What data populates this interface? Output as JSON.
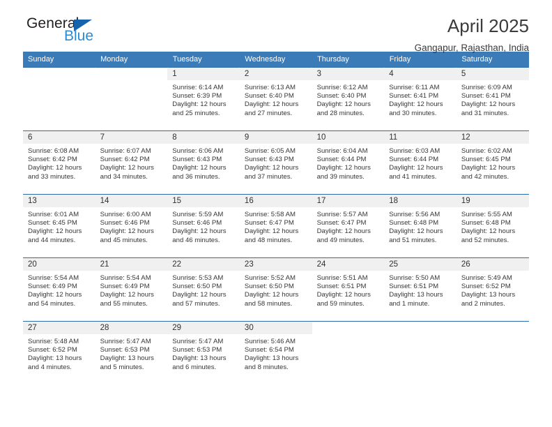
{
  "brand": {
    "name_part1": "General",
    "name_part2": "Blue",
    "triangle_color": "#1663ad",
    "blue_text_color": "#2a8bd4"
  },
  "header": {
    "title": "April 2025",
    "subtitle": "Gangapur, Rajasthan, India"
  },
  "theme": {
    "header_bg": "#3b7cb8",
    "week_divider": "#2d6ca8",
    "daynum_bg": "#f0f0f0"
  },
  "calendar": {
    "weekday_headers": [
      "Sunday",
      "Monday",
      "Tuesday",
      "Wednesday",
      "Thursday",
      "Friday",
      "Saturday"
    ],
    "labels": {
      "sunrise": "Sunrise:",
      "sunset": "Sunset:",
      "daylight": "Daylight:"
    },
    "weeks": [
      [
        {
          "day": "",
          "sunrise": "",
          "sunset": "",
          "daylight": ""
        },
        {
          "day": "",
          "sunrise": "",
          "sunset": "",
          "daylight": ""
        },
        {
          "day": "1",
          "sunrise": "Sunrise: 6:14 AM",
          "sunset": "Sunset: 6:39 PM",
          "daylight": "Daylight: 12 hours and 25 minutes."
        },
        {
          "day": "2",
          "sunrise": "Sunrise: 6:13 AM",
          "sunset": "Sunset: 6:40 PM",
          "daylight": "Daylight: 12 hours and 27 minutes."
        },
        {
          "day": "3",
          "sunrise": "Sunrise: 6:12 AM",
          "sunset": "Sunset: 6:40 PM",
          "daylight": "Daylight: 12 hours and 28 minutes."
        },
        {
          "day": "4",
          "sunrise": "Sunrise: 6:11 AM",
          "sunset": "Sunset: 6:41 PM",
          "daylight": "Daylight: 12 hours and 30 minutes."
        },
        {
          "day": "5",
          "sunrise": "Sunrise: 6:09 AM",
          "sunset": "Sunset: 6:41 PM",
          "daylight": "Daylight: 12 hours and 31 minutes."
        }
      ],
      [
        {
          "day": "6",
          "sunrise": "Sunrise: 6:08 AM",
          "sunset": "Sunset: 6:42 PM",
          "daylight": "Daylight: 12 hours and 33 minutes."
        },
        {
          "day": "7",
          "sunrise": "Sunrise: 6:07 AM",
          "sunset": "Sunset: 6:42 PM",
          "daylight": "Daylight: 12 hours and 34 minutes."
        },
        {
          "day": "8",
          "sunrise": "Sunrise: 6:06 AM",
          "sunset": "Sunset: 6:43 PM",
          "daylight": "Daylight: 12 hours and 36 minutes."
        },
        {
          "day": "9",
          "sunrise": "Sunrise: 6:05 AM",
          "sunset": "Sunset: 6:43 PM",
          "daylight": "Daylight: 12 hours and 37 minutes."
        },
        {
          "day": "10",
          "sunrise": "Sunrise: 6:04 AM",
          "sunset": "Sunset: 6:44 PM",
          "daylight": "Daylight: 12 hours and 39 minutes."
        },
        {
          "day": "11",
          "sunrise": "Sunrise: 6:03 AM",
          "sunset": "Sunset: 6:44 PM",
          "daylight": "Daylight: 12 hours and 41 minutes."
        },
        {
          "day": "12",
          "sunrise": "Sunrise: 6:02 AM",
          "sunset": "Sunset: 6:45 PM",
          "daylight": "Daylight: 12 hours and 42 minutes."
        }
      ],
      [
        {
          "day": "13",
          "sunrise": "Sunrise: 6:01 AM",
          "sunset": "Sunset: 6:45 PM",
          "daylight": "Daylight: 12 hours and 44 minutes."
        },
        {
          "day": "14",
          "sunrise": "Sunrise: 6:00 AM",
          "sunset": "Sunset: 6:46 PM",
          "daylight": "Daylight: 12 hours and 45 minutes."
        },
        {
          "day": "15",
          "sunrise": "Sunrise: 5:59 AM",
          "sunset": "Sunset: 6:46 PM",
          "daylight": "Daylight: 12 hours and 46 minutes."
        },
        {
          "day": "16",
          "sunrise": "Sunrise: 5:58 AM",
          "sunset": "Sunset: 6:47 PM",
          "daylight": "Daylight: 12 hours and 48 minutes."
        },
        {
          "day": "17",
          "sunrise": "Sunrise: 5:57 AM",
          "sunset": "Sunset: 6:47 PM",
          "daylight": "Daylight: 12 hours and 49 minutes."
        },
        {
          "day": "18",
          "sunrise": "Sunrise: 5:56 AM",
          "sunset": "Sunset: 6:48 PM",
          "daylight": "Daylight: 12 hours and 51 minutes."
        },
        {
          "day": "19",
          "sunrise": "Sunrise: 5:55 AM",
          "sunset": "Sunset: 6:48 PM",
          "daylight": "Daylight: 12 hours and 52 minutes."
        }
      ],
      [
        {
          "day": "20",
          "sunrise": "Sunrise: 5:54 AM",
          "sunset": "Sunset: 6:49 PM",
          "daylight": "Daylight: 12 hours and 54 minutes."
        },
        {
          "day": "21",
          "sunrise": "Sunrise: 5:54 AM",
          "sunset": "Sunset: 6:49 PM",
          "daylight": "Daylight: 12 hours and 55 minutes."
        },
        {
          "day": "22",
          "sunrise": "Sunrise: 5:53 AM",
          "sunset": "Sunset: 6:50 PM",
          "daylight": "Daylight: 12 hours and 57 minutes."
        },
        {
          "day": "23",
          "sunrise": "Sunrise: 5:52 AM",
          "sunset": "Sunset: 6:50 PM",
          "daylight": "Daylight: 12 hours and 58 minutes."
        },
        {
          "day": "24",
          "sunrise": "Sunrise: 5:51 AM",
          "sunset": "Sunset: 6:51 PM",
          "daylight": "Daylight: 12 hours and 59 minutes."
        },
        {
          "day": "25",
          "sunrise": "Sunrise: 5:50 AM",
          "sunset": "Sunset: 6:51 PM",
          "daylight": "Daylight: 13 hours and 1 minute."
        },
        {
          "day": "26",
          "sunrise": "Sunrise: 5:49 AM",
          "sunset": "Sunset: 6:52 PM",
          "daylight": "Daylight: 13 hours and 2 minutes."
        }
      ],
      [
        {
          "day": "27",
          "sunrise": "Sunrise: 5:48 AM",
          "sunset": "Sunset: 6:52 PM",
          "daylight": "Daylight: 13 hours and 4 minutes."
        },
        {
          "day": "28",
          "sunrise": "Sunrise: 5:47 AM",
          "sunset": "Sunset: 6:53 PM",
          "daylight": "Daylight: 13 hours and 5 minutes."
        },
        {
          "day": "29",
          "sunrise": "Sunrise: 5:47 AM",
          "sunset": "Sunset: 6:53 PM",
          "daylight": "Daylight: 13 hours and 6 minutes."
        },
        {
          "day": "30",
          "sunrise": "Sunrise: 5:46 AM",
          "sunset": "Sunset: 6:54 PM",
          "daylight": "Daylight: 13 hours and 8 minutes."
        },
        {
          "day": "",
          "sunrise": "",
          "sunset": "",
          "daylight": ""
        },
        {
          "day": "",
          "sunrise": "",
          "sunset": "",
          "daylight": ""
        },
        {
          "day": "",
          "sunrise": "",
          "sunset": "",
          "daylight": ""
        }
      ]
    ]
  }
}
